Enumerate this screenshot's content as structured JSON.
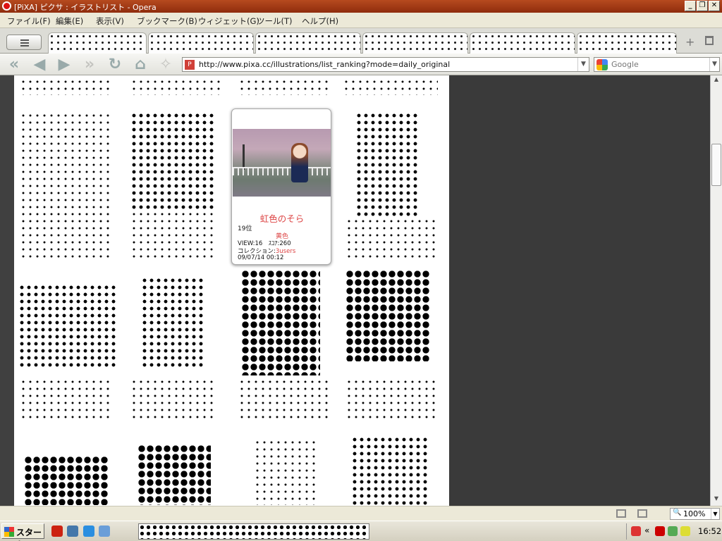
{
  "window": {
    "title": "[PiXA] ピクサ : イラストリスト - Opera",
    "controls": {
      "minimize": "_",
      "restore": "❐",
      "close": "✕"
    }
  },
  "menu": [
    {
      "label": "ファイル(F)"
    },
    {
      "label": "編集(E)"
    },
    {
      "label": "表示(V)"
    },
    {
      "label": "ブックマーク(B)"
    },
    {
      "label": "ウィジェット(G)"
    },
    {
      "label": "ツール(T)"
    },
    {
      "label": "ヘルプ(H)"
    }
  ],
  "toolbar": {
    "address": "http://www.pixa.cc/illustrations/list_ranking?mode=daily_original",
    "search_engine": "Google",
    "tab_add": "+"
  },
  "card": {
    "title": "虹色のそら",
    "rank": "19位",
    "author": "黄色",
    "stats": "VIEW:16　ｽｺｱ:260",
    "collection_label": "コレクション:",
    "collection_users": "3users",
    "date": "09/07/14 00:12"
  },
  "statusbar": {
    "zoom": "100%"
  },
  "taskbar": {
    "start": "スタート",
    "clock": "16:52"
  },
  "colors": {
    "accent_red": "#dd4444",
    "titlebar": "#a33a14",
    "content_bg": "#3a3a3a"
  }
}
